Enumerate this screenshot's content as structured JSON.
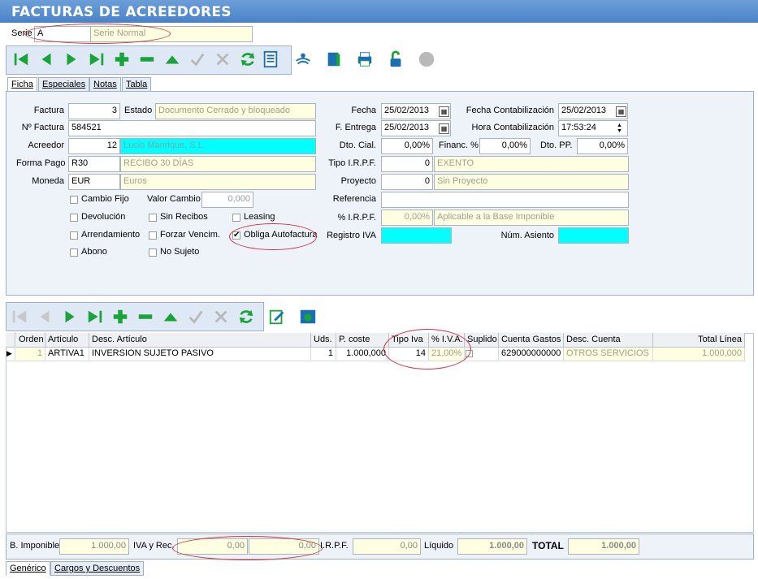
{
  "window": {
    "title": "FACTURAS DE ACREEDORES"
  },
  "serie": {
    "label": "Serie",
    "code": "A",
    "name": "Serie Normal"
  },
  "tabs": [
    "Ficha",
    "Especiales",
    "Notas",
    "Tabla"
  ],
  "form": {
    "factura_label": "Factura",
    "factura": "3",
    "estado_label": "Estado",
    "estado": "Documento Cerrado y bloqueado",
    "nfactura_label": "Nº Factura",
    "nfactura": "584521",
    "acreedor_label": "Acreedor",
    "acreedor": "12",
    "acreedor_name": "Lucio Manrique, S.L.",
    "formapago_label": "Forma Pago",
    "formapago": "R30",
    "formapago_name": "RECIBO 30 DÍAS",
    "moneda_label": "Moneda",
    "moneda": "EUR",
    "moneda_name": "Euros",
    "cambio_fijo": "Cambio Fijo",
    "valor_cambio_label": "Valor Cambio",
    "valor_cambio": "0,000",
    "devolucion": "Devolución",
    "sin_recibos": "Sin Recibos",
    "leasing": "Leasing",
    "arrendamiento": "Arrendamiento",
    "forzar": "Forzar Vencim.",
    "obliga": "Obliga Autofactura",
    "abono": "Abono",
    "no_sujeto": "No Sujeto",
    "fecha_label": "Fecha",
    "fecha": "25/02/2013",
    "fentrega_label": "F. Entrega",
    "fentrega": "25/02/2013",
    "dtocial_label": "Dto. Cial.",
    "dtocial": "0,00%",
    "financ_label": "Financ. %",
    "financ": "0,00%",
    "dtopp_label": "Dto. PP.",
    "dtopp": "0,00%",
    "tipoirpf_label": "Tipo I.R.P.F.",
    "tipoirpf": "0",
    "tipoirpf_name": "EXENTO",
    "proyecto_label": "Proyecto",
    "proyecto": "0",
    "proyecto_name": "Sin Proyecto",
    "referencia_label": "Referencia",
    "referencia": "",
    "pirpf_label": "% I.R.P.F.",
    "pirpf": "0,00%",
    "pirpf_name": "Aplicable a la Base Imponible",
    "registroiva_label": "Registro IVA",
    "registroiva": "",
    "fechacont_label": "Fecha Contabilización",
    "fechacont": "25/02/2013",
    "horacont_label": "Hora Contabilización",
    "horacont": "17:53:24",
    "numasiento_label": "Núm. Asiento",
    "numasiento": ""
  },
  "grid": {
    "headers": [
      "Orden",
      "Artículo",
      "Desc. Artículo",
      "Uds.",
      "P. coste",
      "Tipo Iva",
      "% I.V.A.",
      "Suplido",
      "Cuenta Gastos",
      "Desc. Cuenta",
      "Total Línea"
    ],
    "row": [
      "1",
      "ARTIVA1",
      "INVERSION SUJETO PASIVO",
      "1",
      "1.000,000",
      "14",
      "21,00%",
      "",
      "629000000000",
      "OTROS SERVICIOS",
      "1.000,000"
    ]
  },
  "totals": {
    "bimp_label": "B. Imponible",
    "bimp": "1.000,00",
    "iva_label": "IVA y Rec.",
    "iva": "0,00",
    "rec": "0,00",
    "irpf_label": "I.R.P.F.",
    "irpf": "0,00",
    "liquido_label": "Líquido",
    "liquido": "1.000,00",
    "total_label": "TOTAL",
    "total": "1.000,00"
  },
  "bottom_tabs": [
    "Genérico",
    "Cargos y Descuentos"
  ],
  "colors": {
    "accent": "#4a82c8",
    "nav_green": "#1aa33a",
    "highlight_cyan": "#00ffff",
    "annotation": "#d0343c"
  }
}
